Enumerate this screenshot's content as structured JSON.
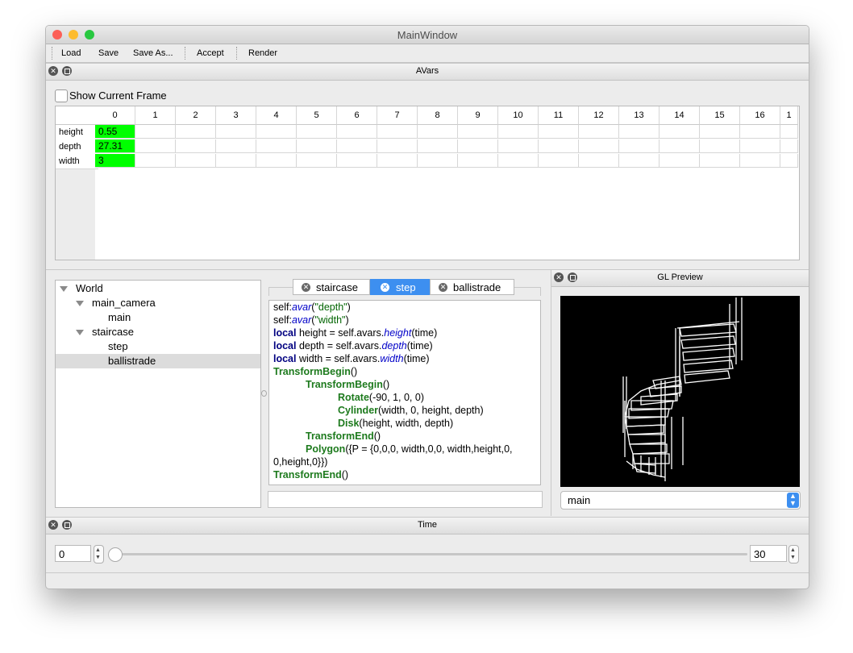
{
  "window": {
    "title": "MainWindow"
  },
  "toolbar": {
    "load": "Load",
    "save": "Save",
    "save_as": "Save As...",
    "accept": "Accept",
    "render": "Render"
  },
  "avars": {
    "title": "AVars",
    "show_current_frame": "Show Current Frame",
    "show_current_frame_checked": false,
    "columns": [
      "0",
      "1",
      "2",
      "3",
      "4",
      "5",
      "6",
      "7",
      "8",
      "9",
      "10",
      "11",
      "12",
      "13",
      "14",
      "15",
      "16",
      "1"
    ],
    "rows": [
      {
        "label": "height",
        "value": "0.55"
      },
      {
        "label": "depth",
        "value": "27.31"
      },
      {
        "label": "width",
        "value": "3"
      }
    ],
    "highlight_color": "#00ff00"
  },
  "tree": {
    "world": "World",
    "main_camera": "main_camera",
    "main": "main",
    "staircase": "staircase",
    "step": "step",
    "ballistrade": "ballistrade",
    "selected": "ballistrade"
  },
  "editor": {
    "tabs": [
      "staircase",
      "step",
      "ballistrade"
    ],
    "active_tab": "step"
  },
  "gl_preview": {
    "title": "GL Preview",
    "camera": "main"
  },
  "time": {
    "title": "Time",
    "start": "0",
    "end": "30",
    "slider_value": 0
  },
  "colors": {
    "accent": "#3d8ff0",
    "keyword": "#000080",
    "function": "#1d7a1d",
    "avar": "#0000c8"
  }
}
